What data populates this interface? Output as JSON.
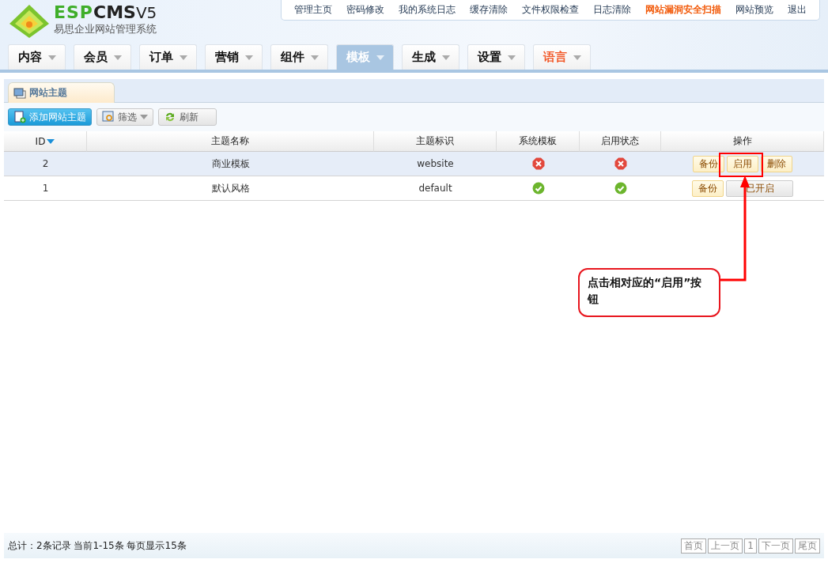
{
  "logo": {
    "brand_a": "ESP",
    "brand_b": "CMS",
    "version": "V5",
    "subtitle": "易思企业网站管理系统"
  },
  "top_links": [
    {
      "label": "管理主页",
      "emphasized": false
    },
    {
      "label": "密码修改",
      "emphasized": false
    },
    {
      "label": "我的系统日志",
      "emphasized": false
    },
    {
      "label": "缓存清除",
      "emphasized": false
    },
    {
      "label": "文件权限检查",
      "emphasized": false
    },
    {
      "label": "日志清除",
      "emphasized": false
    },
    {
      "label": "网站漏洞安全扫描",
      "emphasized": true
    },
    {
      "label": "网站预览",
      "emphasized": false
    },
    {
      "label": "退出",
      "emphasized": false
    }
  ],
  "nav": [
    {
      "label": "内容",
      "selected": false,
      "emphasized": false
    },
    {
      "label": "会员",
      "selected": false,
      "emphasized": false
    },
    {
      "label": "订单",
      "selected": false,
      "emphasized": false
    },
    {
      "label": "营销",
      "selected": false,
      "emphasized": false
    },
    {
      "label": "组件",
      "selected": false,
      "emphasized": false
    },
    {
      "label": "模板",
      "selected": true,
      "emphasized": false
    },
    {
      "label": "生成",
      "selected": false,
      "emphasized": false
    },
    {
      "label": "设置",
      "selected": false,
      "emphasized": false
    },
    {
      "label": "语言",
      "selected": false,
      "emphasized": true
    }
  ],
  "panel_tab": "网站主题",
  "toolbar": [
    {
      "label": "添加网站主题",
      "kind": "primary"
    },
    {
      "label": "筛选",
      "kind": "dropdown"
    },
    {
      "label": "刷新",
      "kind": "refresh"
    }
  ],
  "table": {
    "columns": [
      "ID",
      "主题名称",
      "主题标识",
      "系统模板",
      "启用状态",
      "操作"
    ],
    "rows": [
      {
        "id": "2",
        "name": "商业模板",
        "ident": "website",
        "system": false,
        "enabled": false,
        "selected": true,
        "actions": [
          {
            "label": "备份",
            "kind": "normal"
          },
          {
            "label": "启用",
            "kind": "normal"
          },
          {
            "label": "删除",
            "kind": "normal"
          }
        ]
      },
      {
        "id": "1",
        "name": "默认风格",
        "ident": "default",
        "system": true,
        "enabled": true,
        "selected": false,
        "actions": [
          {
            "label": "备份",
            "kind": "normal"
          },
          {
            "label": "已开启",
            "kind": "inactive"
          }
        ]
      }
    ]
  },
  "callout": "点击相对应的“启用”按钮",
  "footer": {
    "summary": "总计：2条记录 当前1-15条 每页显示15条",
    "pages": [
      "首页",
      "上一页",
      "1",
      "下一页",
      "尾页"
    ]
  }
}
